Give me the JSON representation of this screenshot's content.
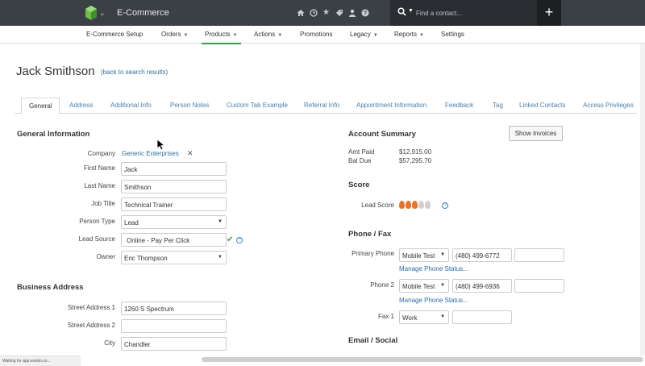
{
  "topbar": {
    "app_title": "E-Commerce",
    "search_placeholder": "Find a contact...",
    "plus_label": "+"
  },
  "nav": {
    "items": [
      {
        "label": "E-Commerce Setup",
        "dropdown": false
      },
      {
        "label": "Orders",
        "dropdown": true
      },
      {
        "label": "Products",
        "dropdown": true,
        "active": true
      },
      {
        "label": "Actions",
        "dropdown": true
      },
      {
        "label": "Promotions",
        "dropdown": false
      },
      {
        "label": "Legacy",
        "dropdown": true
      },
      {
        "label": "Reports",
        "dropdown": true
      },
      {
        "label": "Settings",
        "dropdown": false
      }
    ]
  },
  "contact": {
    "name": "Jack Smithson",
    "back_link": "(back to search results)"
  },
  "tabs": [
    {
      "label": "General",
      "active": true
    },
    {
      "label": "Address"
    },
    {
      "label": "Additional Info"
    },
    {
      "label": "Person Notes"
    },
    {
      "label": "Custom Tab Example"
    },
    {
      "label": "Referral Info"
    },
    {
      "label": "Appointment Information"
    },
    {
      "label": "Feedback"
    },
    {
      "label": "Tag"
    },
    {
      "label": "Linked Contacts"
    },
    {
      "label": "Access Privileges"
    }
  ],
  "general": {
    "title": "General Information",
    "company_label": "Company",
    "company_value": "Generic Enterprises",
    "first_name_label": "First Name",
    "first_name": "Jack",
    "last_name_label": "Last Name",
    "last_name": "Smithson",
    "job_title_label": "Job Title",
    "job_title": "Technical Trainer",
    "person_type_label": "Person Type",
    "person_type": "Lead",
    "lead_source_label": "Lead Source",
    "lead_source": "Online - Pay Per Click",
    "owner_label": "Owner",
    "owner": "Eric Thompson"
  },
  "business_address": {
    "title": "Business Address",
    "street1_label": "Street Address 1",
    "street1": "1260 S Spectrum",
    "street2_label": "Street Address 2",
    "street2": "",
    "city_label": "City",
    "city": "Chandler"
  },
  "account": {
    "title": "Account Summary",
    "show_invoices": "Show Invoices",
    "amt_paid_label": "Amt Paid",
    "amt_paid": "$12,915.00",
    "bal_due_label": "Bal Due",
    "bal_due": "$57,295.70"
  },
  "score": {
    "title": "Score",
    "lead_score_label": "Lead Score",
    "lead_score": 3,
    "max_score": 5
  },
  "phone": {
    "title": "Phone / Fax",
    "primary_label": "Primary Phone",
    "primary_type": "Mobile Test",
    "primary_number": "(480) 499-6772",
    "primary_ext": "",
    "manage1": "Manage Phone Status...",
    "phone2_label": "Phone 2",
    "phone2_type": "Mobile Test",
    "phone2_number": "(480) 499-6936",
    "phone2_ext": "",
    "manage2": "Manage Phone Status...",
    "fax1_label": "Fax 1",
    "fax1_type": "Work",
    "fax1_number": ""
  },
  "email": {
    "title": "Email / Social"
  },
  "status_bar": "Waiting for app.eresto.co...",
  "colors": {
    "topbar": "#3b3f46",
    "accent_green": "#2fa04a",
    "link_blue": "#2e6da4",
    "flame_active": "#e8742a",
    "flame_inactive": "#d0d0d0"
  }
}
